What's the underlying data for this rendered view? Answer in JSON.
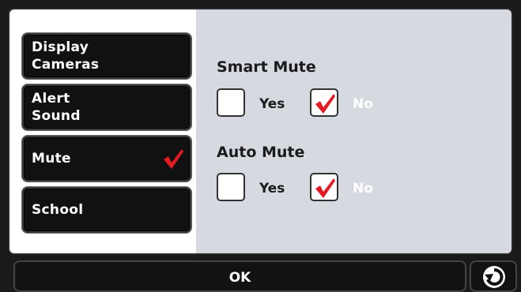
{
  "menu": {
    "items": [
      {
        "label": "Display\nCameras"
      },
      {
        "label": "Alert\nSound"
      },
      {
        "label": "Mute"
      },
      {
        "label": "School"
      }
    ]
  },
  "settings": {
    "smart_mute": {
      "title": "Smart Mute",
      "yes": "Yes",
      "no": "No",
      "selected": "No"
    },
    "auto_mute": {
      "title": "Auto Mute",
      "yes": "Yes",
      "no": "No",
      "selected": "No"
    }
  },
  "footer": {
    "ok_label": "OK"
  },
  "icons": {
    "check": "checkmark-icon",
    "back": "back-arrow-icon"
  },
  "colors": {
    "check_red": "#e31b23",
    "panel_grey": "#d6d9df",
    "button_black": "#111111"
  }
}
